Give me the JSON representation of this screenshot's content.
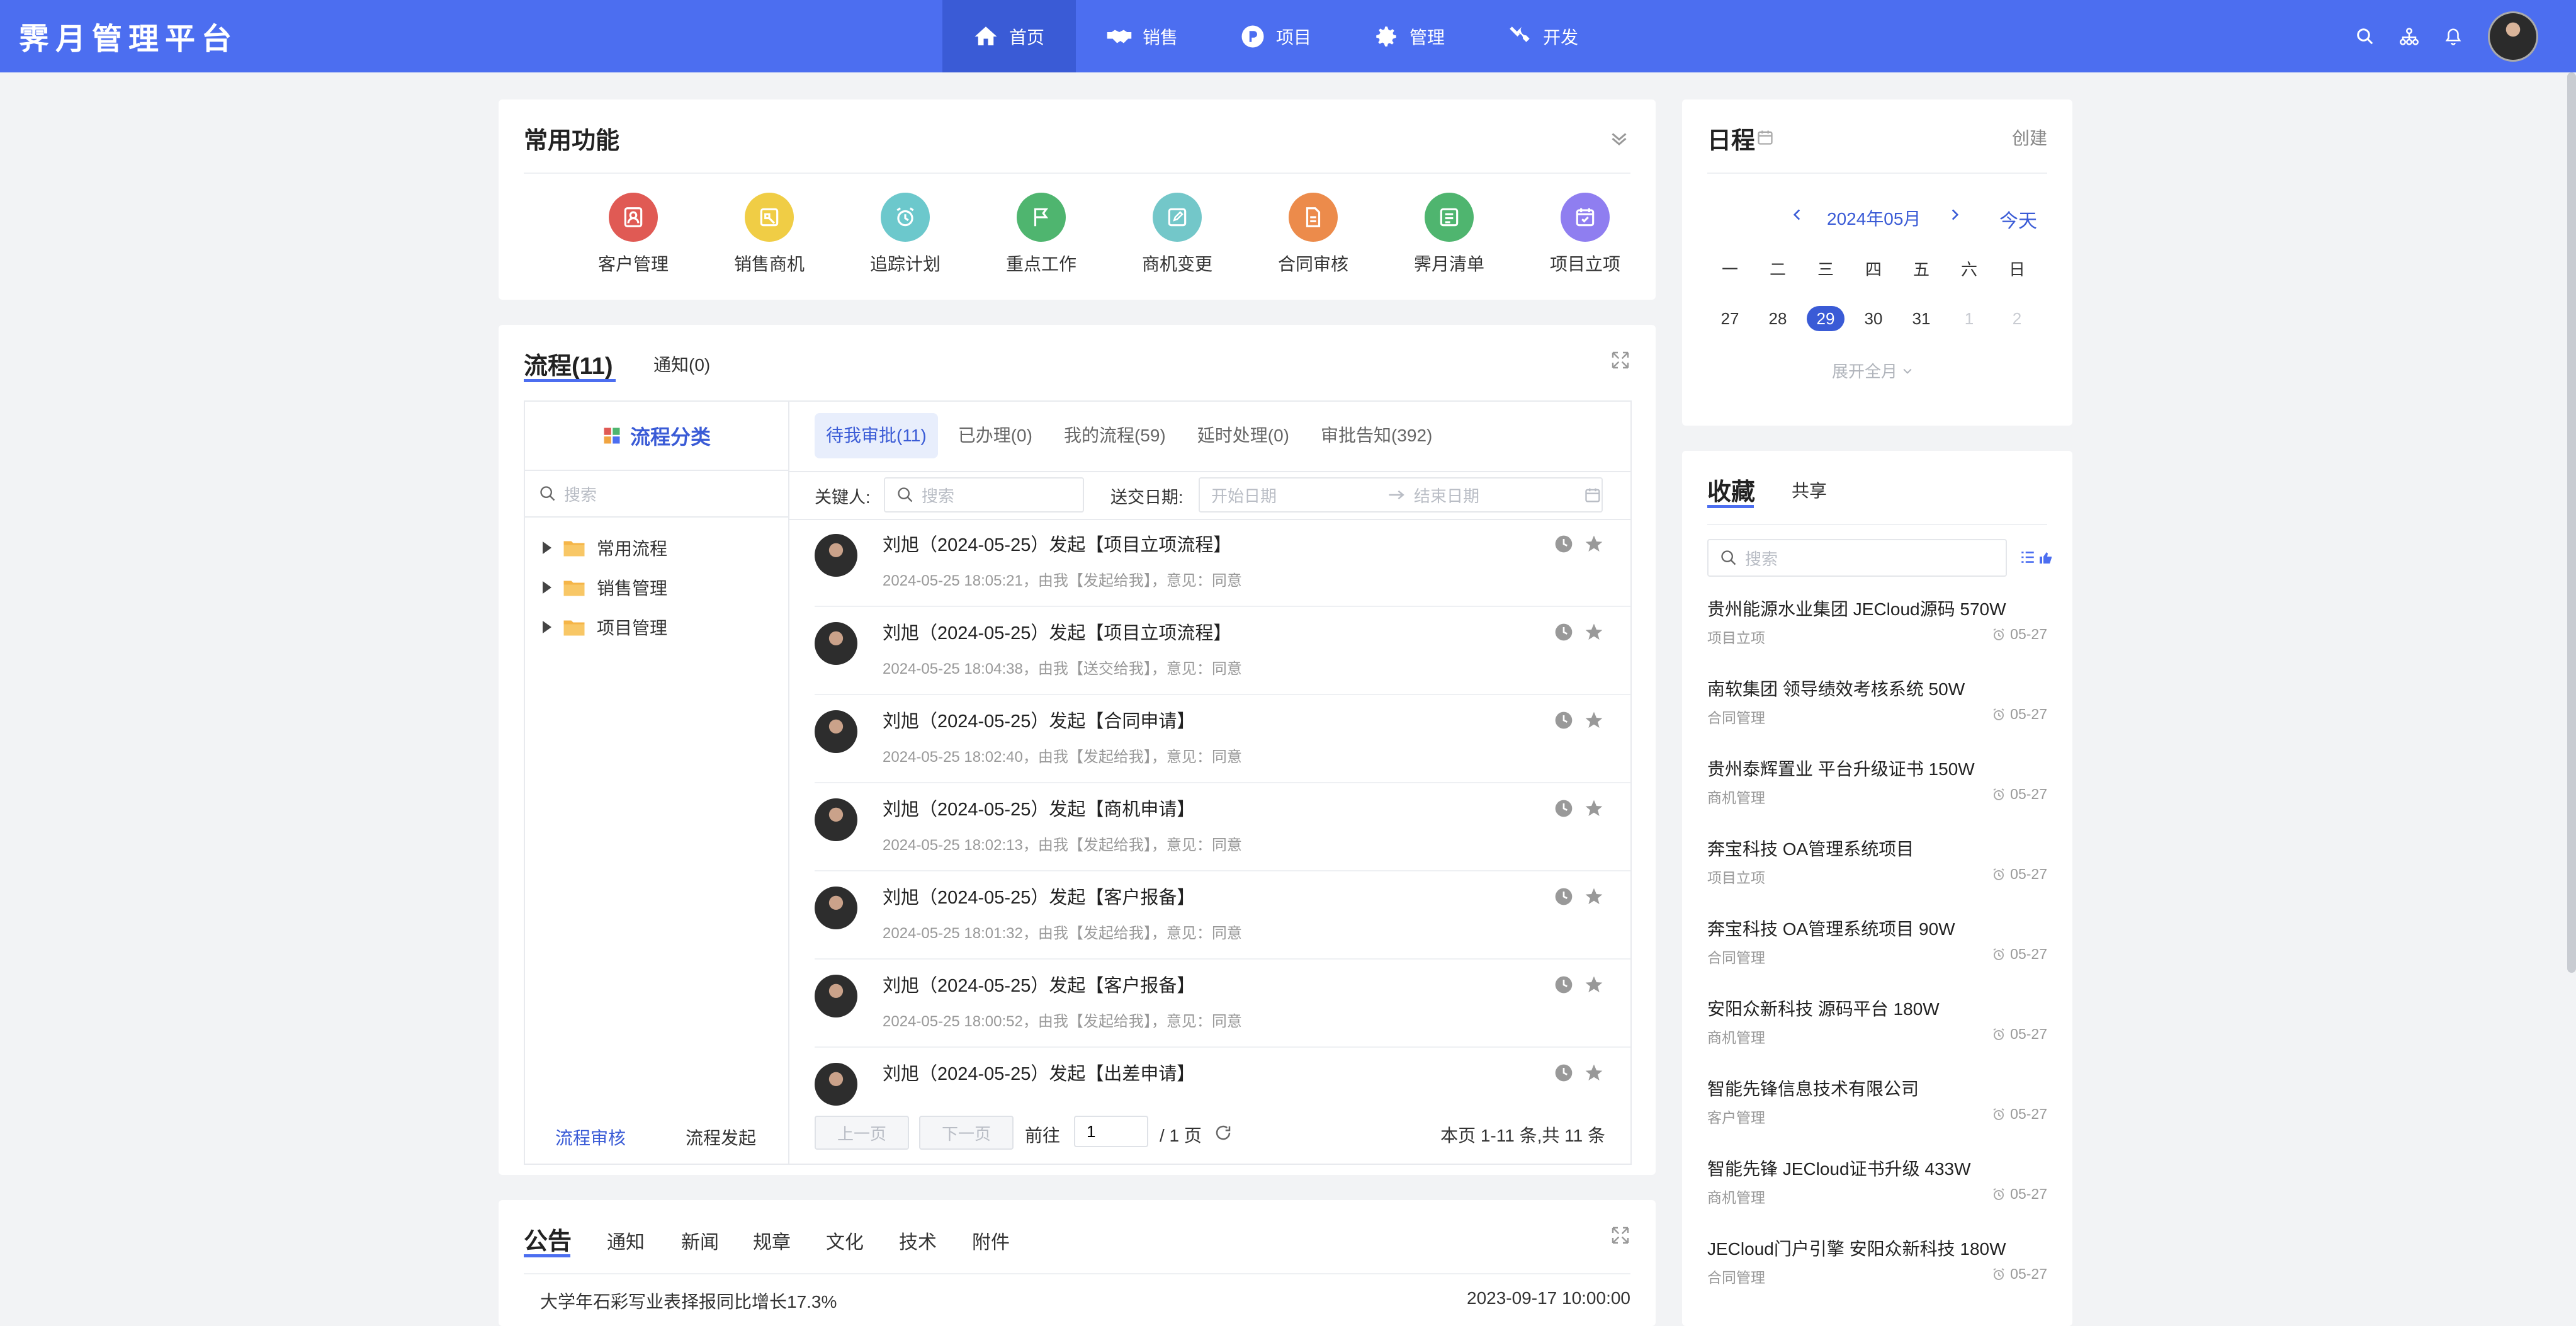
{
  "app": {
    "title": "霁月管理平台"
  },
  "nav": {
    "items": [
      {
        "label": "首页",
        "icon": "home-icon"
      },
      {
        "label": "销售",
        "icon": "handshake-icon"
      },
      {
        "label": "项目",
        "icon": "project-p-icon"
      },
      {
        "label": "管理",
        "icon": "gear-icon"
      },
      {
        "label": "开发",
        "icon": "tools-icon"
      }
    ],
    "active": "首页"
  },
  "common": {
    "title": "常用功能",
    "items": [
      {
        "label": "客户管理",
        "color": "#e05a54"
      },
      {
        "label": "销售商机",
        "color": "#f0cd45"
      },
      {
        "label": "追踪计划",
        "color": "#6cc8cc"
      },
      {
        "label": "重点工作",
        "color": "#4fb56f"
      },
      {
        "label": "商机变更",
        "color": "#73c7c9"
      },
      {
        "label": "合同审核",
        "color": "#ec8b4b"
      },
      {
        "label": "霁月清单",
        "color": "#4fb56f"
      },
      {
        "label": "项目立项",
        "color": "#8f7ef0"
      }
    ]
  },
  "process": {
    "tab_main": "流程(11)",
    "tab_notice": "通知(0)",
    "category_title": "流程分类",
    "search_placeholder": "搜索",
    "tree": [
      "常用流程",
      "销售管理",
      "项目管理"
    ],
    "footer_left": "流程审核",
    "footer_right": "流程发起",
    "subtabs": [
      "待我审批(11)",
      "已办理(0)",
      "我的流程(59)",
      "延时处理(0)",
      "审批告知(392)"
    ],
    "filter_keyperson": "关键人:",
    "filter_search": "搜索",
    "filter_date": "送交日期:",
    "start_date": "开始日期",
    "end_date": "结束日期",
    "rows": [
      {
        "title": "刘旭（2024-05-25）发起【项目立项流程】",
        "sub": "2024-05-25 18:05:21，由我【发起给我】，意见：同意"
      },
      {
        "title": "刘旭（2024-05-25）发起【项目立项流程】",
        "sub": "2024-05-25 18:04:38，由我【送交给我】，意见：同意"
      },
      {
        "title": "刘旭（2024-05-25）发起【合同申请】",
        "sub": "2024-05-25 18:02:40，由我【发起给我】，意见：同意"
      },
      {
        "title": "刘旭（2024-05-25）发起【商机申请】",
        "sub": "2024-05-25 18:02:13，由我【发起给我】，意见：同意"
      },
      {
        "title": "刘旭（2024-05-25）发起【客户报备】",
        "sub": "2024-05-25 18:01:32，由我【发起给我】，意见：同意"
      },
      {
        "title": "刘旭（2024-05-25）发起【客户报备】",
        "sub": "2024-05-25 18:00:52，由我【发起给我】，意见：同意"
      },
      {
        "title": "刘旭（2024-05-25）发起【出差申请】",
        "sub": ""
      }
    ],
    "pager": {
      "prev": "上一页",
      "next": "下一页",
      "goto": "前往",
      "page": "1",
      "total_pages": "/ 1 页",
      "summary": "本页 1-11 条,共 11 条"
    }
  },
  "announce": {
    "tabs": [
      "公告",
      "通知",
      "新闻",
      "规章",
      "文化",
      "技术",
      "附件"
    ],
    "first_row": "大学年石彩写业表择报同比增长17.3%",
    "first_date": "2023-09-17 10:00:00"
  },
  "schedule": {
    "title": "日程",
    "create": "创建",
    "month": "2024年05月",
    "today": "今天",
    "weekdays": [
      "一",
      "二",
      "三",
      "四",
      "五",
      "六",
      "日"
    ],
    "days": [
      "27",
      "28",
      "29",
      "30",
      "31",
      "1",
      "2"
    ],
    "selected": "29",
    "expand": "展开全月"
  },
  "favorites": {
    "tab_main": "收藏",
    "tab_share": "共享",
    "search_placeholder": "搜索",
    "items": [
      {
        "title": "贵州能源水业集团 JECloud源码 570W",
        "cat": "项目立项",
        "date": "05-27"
      },
      {
        "title": "南软集团 领导绩效考核系统 50W",
        "cat": "合同管理",
        "date": "05-27"
      },
      {
        "title": "贵州泰辉置业 平台升级证书 150W",
        "cat": "商机管理",
        "date": "05-27"
      },
      {
        "title": "奔宝科技 OA管理系统项目",
        "cat": "项目立项",
        "date": "05-27"
      },
      {
        "title": "奔宝科技 OA管理系统项目 90W",
        "cat": "合同管理",
        "date": "05-27"
      },
      {
        "title": "安阳众新科技 源码平台 180W",
        "cat": "商机管理",
        "date": "05-27"
      },
      {
        "title": "智能先锋信息技术有限公司",
        "cat": "客户管理",
        "date": "05-27"
      },
      {
        "title": "智能先锋 JECloud证书升级 433W",
        "cat": "商机管理",
        "date": "05-27"
      },
      {
        "title": "JECloud门户引擎 安阳众新科技 180W",
        "cat": "合同管理",
        "date": "05-27"
      }
    ]
  }
}
